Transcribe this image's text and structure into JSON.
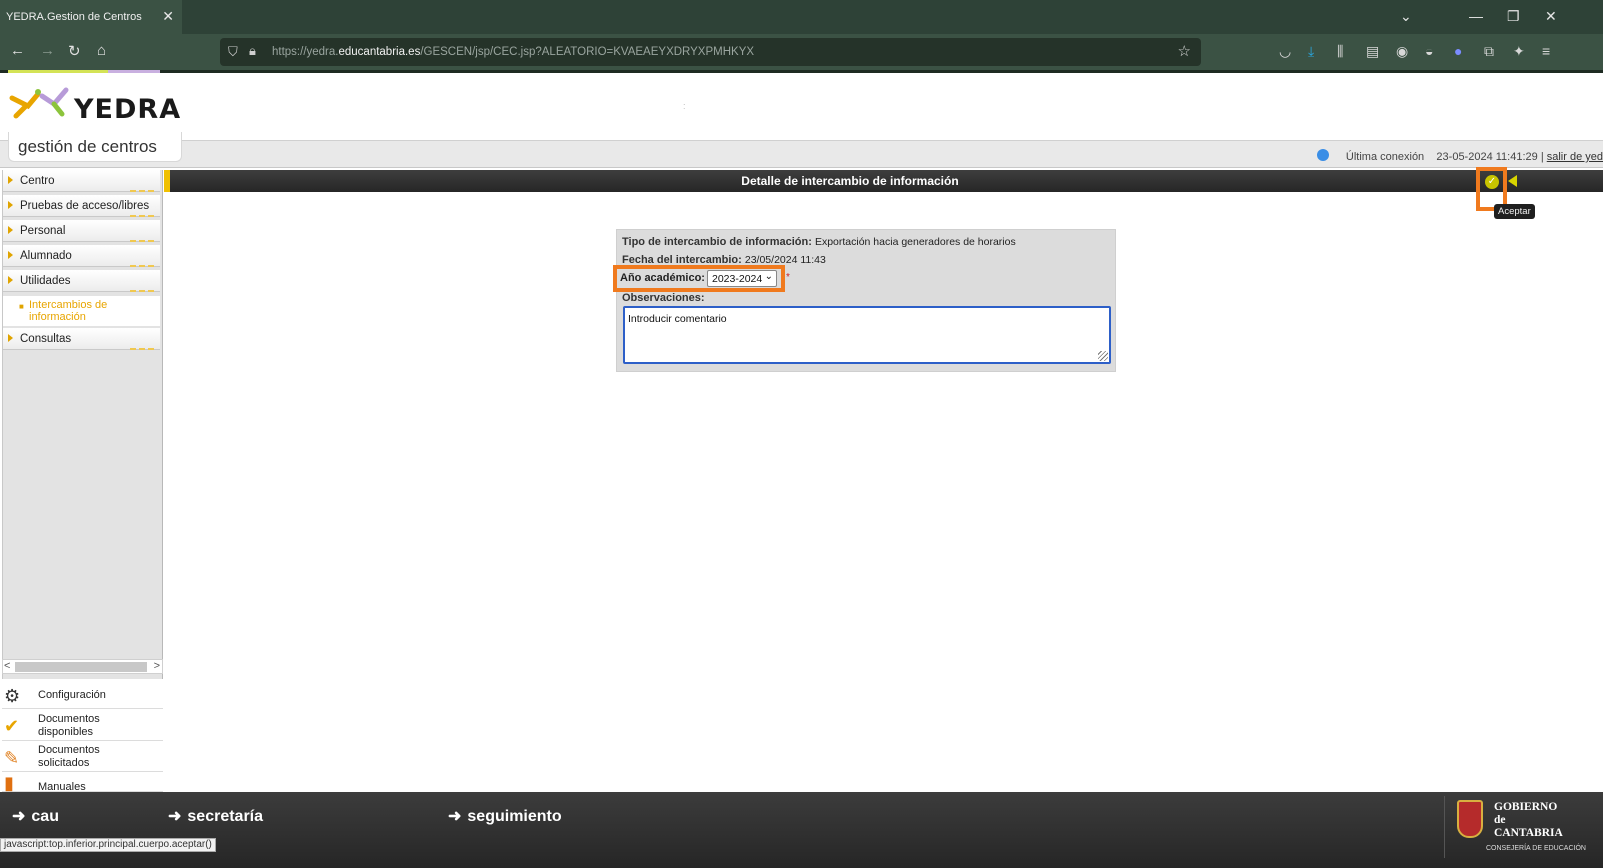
{
  "browser": {
    "tab_title": "YEDRA.Gestion de Centros",
    "tab_close": "✕",
    "url_domain_prefix": "https://yedra.",
    "url_domain": "educantabria.es",
    "url_path": "/GESCEN/jsp/CEC.jsp?ALEATORIO=KVAEAEYXDRYXPMHKYX",
    "window_controls": {
      "list": "⌄",
      "minimize": "—",
      "restore": "❐",
      "close": "✕"
    }
  },
  "header": {
    "logo_text": "YEDRA",
    "subtitle": "gestión de centros",
    "connection_label": "Última conexión",
    "connection_time": "23-05-2024 11:41:29",
    "separator": "|",
    "logout_link": "salir de yed"
  },
  "sidebar": {
    "items": [
      {
        "label": "Centro"
      },
      {
        "label": "Pruebas de acceso/libres"
      },
      {
        "label": "Personal"
      },
      {
        "label": "Alumnado"
      },
      {
        "label": "Utilidades"
      },
      {
        "label": "Consultas"
      }
    ],
    "submenu_label": "Intercambios de información",
    "scroll_left": "<",
    "scroll_right": ">"
  },
  "tools": {
    "configuracion": "Configuración",
    "documentos_disponibles": "Documentos disponibles",
    "documentos_solicitados": "Documentos solicitados",
    "manuales": "Manuales"
  },
  "content": {
    "title": "Detalle de intercambio de información",
    "tooltip": "Aceptar",
    "tipo_label": "Tipo de intercambio de información:",
    "tipo_value": "Exportación hacia generadores de horarios",
    "fecha_label": "Fecha del intercambio:",
    "fecha_value": "23/05/2024 11:43",
    "anio_label": "Año académico:",
    "anio_value": "2023-2024",
    "required_mark": "*",
    "obs_label": "Observaciones:",
    "obs_value": "Introducir comentario"
  },
  "footer": {
    "links": [
      "cau",
      "secretaría",
      "seguimiento"
    ],
    "gobierno_line1": "GOBIERNO",
    "gobierno_line2": "de",
    "gobierno_line3": "CANTABRIA",
    "consejeria": "CONSEJERÍA DE EDUCACIÓN"
  },
  "status_bar_url": "javascript:top.inferior.principal.cuerpo.aceptar()",
  "colors": {
    "accent_orange": "#f07a1e",
    "menu_yellow": "#e8a500",
    "title_bar": "#2e2e2e"
  }
}
